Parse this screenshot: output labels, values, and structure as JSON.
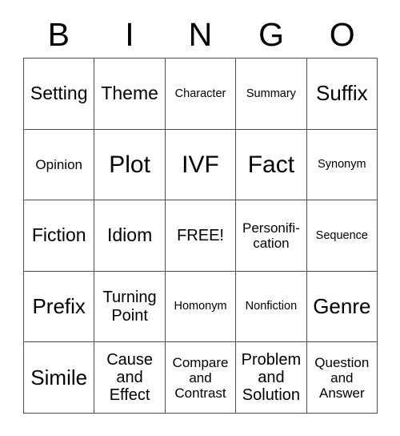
{
  "card": {
    "header_letters": [
      "B",
      "I",
      "N",
      "G",
      "O"
    ],
    "rows": [
      [
        {
          "label": "Setting",
          "size": "lg"
        },
        {
          "label": "Theme",
          "size": "lg"
        },
        {
          "label": "Character",
          "size": "xs"
        },
        {
          "label": "Summary",
          "size": "xs"
        },
        {
          "label": "Suffix",
          "size": "xl"
        }
      ],
      [
        {
          "label": "Opinion",
          "size": "sm"
        },
        {
          "label": "Plot",
          "size": "xxl"
        },
        {
          "label": "IVF",
          "size": "xxl"
        },
        {
          "label": "Fact",
          "size": "xxl"
        },
        {
          "label": "Synonym",
          "size": "xs"
        }
      ],
      [
        {
          "label": "Fiction",
          "size": "lg"
        },
        {
          "label": "Idiom",
          "size": "lg"
        },
        {
          "label": "FREE!",
          "size": "md"
        },
        {
          "label": "Personifi-\ncation",
          "size": "sm"
        },
        {
          "label": "Sequence",
          "size": "xs"
        }
      ],
      [
        {
          "label": "Prefix",
          "size": "xl"
        },
        {
          "label": "Turning\nPoint",
          "size": "md"
        },
        {
          "label": "Homonym",
          "size": "xs"
        },
        {
          "label": "Nonfiction",
          "size": "xs"
        },
        {
          "label": "Genre",
          "size": "xl"
        }
      ],
      [
        {
          "label": "Simile",
          "size": "xl"
        },
        {
          "label": "Cause\nand\nEffect",
          "size": "md"
        },
        {
          "label": "Compare\nand\nContrast",
          "size": "sm"
        },
        {
          "label": "Problem\nand\nSolution",
          "size": "md"
        },
        {
          "label": "Question\nand\nAnswer",
          "size": "sm"
        }
      ]
    ]
  },
  "colors": {
    "grid_line": "#4d4d4d",
    "text": "#000000",
    "background": "#ffffff"
  }
}
